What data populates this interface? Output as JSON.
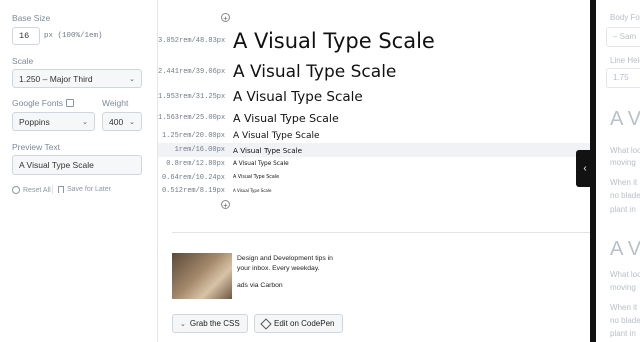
{
  "sidebar": {
    "base_size_label": "Base Size",
    "base_size_value": "16",
    "base_size_unit": "px (100%/1em)",
    "scale_label": "Scale",
    "scale_value": "1.250 – Major Third",
    "google_fonts_label": "Google Fonts",
    "weight_label": "Weight",
    "font_value": "Poppins",
    "weight_value": "400",
    "preview_label": "Preview Text",
    "preview_value": "A Visual Type Scale",
    "reset_label": "Reset All",
    "save_label": "Save for Later"
  },
  "scale_rows": [
    {
      "measure": "3.052rem/48.83px",
      "text": "A Visual Type Scale"
    },
    {
      "measure": "2.441rem/39.06px",
      "text": "A Visual Type Scale"
    },
    {
      "measure": "1.953rem/31.25px",
      "text": "A Visual Type Scale"
    },
    {
      "measure": "1.563rem/25.00px",
      "text": "A Visual Type Scale"
    },
    {
      "measure": "1.25rem/20.00px",
      "text": "A Visual Type Scale"
    },
    {
      "measure": "1rem/16.00px",
      "text": "A Visual Type Scale"
    },
    {
      "measure": "0.8rem/12.80px",
      "text": "A Visual Type Scale"
    },
    {
      "measure": "0.64rem/10.24px",
      "text": "A Visual Type Scale"
    },
    {
      "measure": "0.512rem/8.19px",
      "text": "A Visual Type Scale"
    }
  ],
  "ad": {
    "line1": "Design and Development tips in",
    "line2": "your inbox. Every weekday.",
    "via": "ads via Carbon"
  },
  "buttons": {
    "grab_css": "Grab the CSS",
    "edit_codepen": "Edit on CodePen"
  },
  "right_panel": {
    "body_font_label": "Body Fo",
    "body_font_value": "– Sam",
    "line_height_label": "Line Heig",
    "line_height_value": "1.75",
    "heading1": "A V",
    "p1_line1": "What loo",
    "p1_line2": "moving",
    "p2_line1": "When it",
    "p2_line2": "no blade",
    "p2_line3": "plant in",
    "heading2": "A V",
    "p3_line1": "What loo",
    "p3_line2": "moving",
    "p4_line1": "When it",
    "p4_line2": "no blade",
    "p4_line3": "plant in"
  }
}
